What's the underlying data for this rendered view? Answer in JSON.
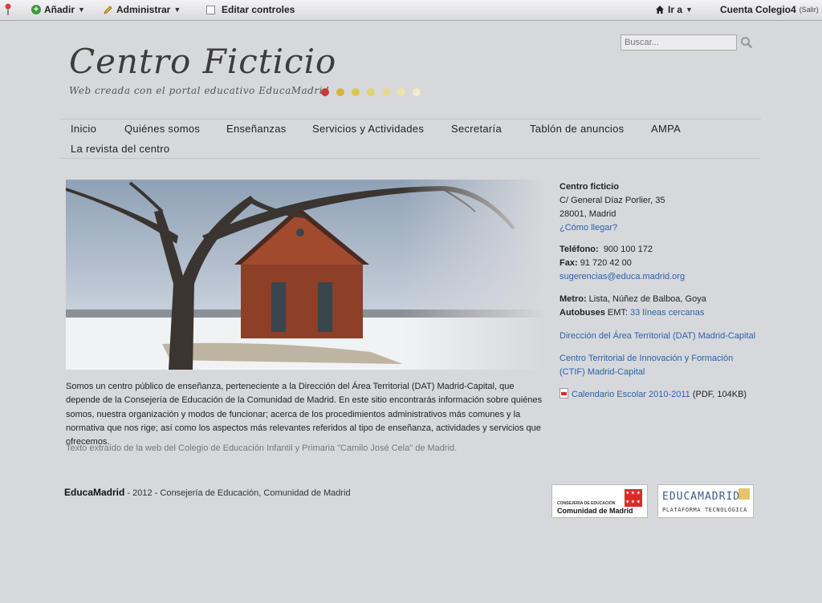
{
  "toolbar": {
    "add_label": "Añadir",
    "admin_label": "Administrar",
    "edit_controls_label": "Editar controles",
    "goto_label": "Ir a",
    "account_label": "Cuenta Colegio4",
    "logout_label": "(Salir)"
  },
  "header": {
    "title": "Centro Ficticio",
    "subtitle": "Web creada con el portal educativo EducaMadrid",
    "dot_colors": [
      "#cc3b33",
      "#d6b43a",
      "#ddc64f",
      "#e3d170",
      "#e8da8c",
      "#eee3a9",
      "#f2ecc8"
    ]
  },
  "search": {
    "placeholder": "Buscar..."
  },
  "nav": {
    "items": [
      "Inicio",
      "Quiénes somos",
      "Enseñanzas",
      "Servicios y Actividades",
      "Secretaría",
      "Tablón de anuncios",
      "AMPA",
      "La revista del centro"
    ]
  },
  "main": {
    "intro": "Somos un centro público de enseñanza, perteneciente a la Dirección del Área Territorial (DAT) Madrid-Capital, que depende de la Consejería de Educación de la Comunidad de Madrid. En este sitio encontrarás información sobre quiénes somos, nuestra organización y modos de funcionar; acerca de los procedimientos administrativos más comunes y la normativa que nos rige; así como los aspectos más relevantes referidos al tipo de enseñanza, actividades y servicios que ofrecemos.",
    "source_note": "Texto extraído de la web del Colegio de Educación Infantil y Primaria \"Camilo José Cela\" de Madrid."
  },
  "sidebar": {
    "school_name": "Centro ficticio",
    "address_line1": "C/ General Díaz Porlier, 35",
    "address_line2": "28001, Madrid",
    "directions_link": "¿Cómo llegar?",
    "phone_label": "Teléfono:",
    "phone_value": "900 100 172",
    "fax_label": "Fax:",
    "fax_value": "91 720 42 00",
    "email": "sugerencias@educa.madrid.org",
    "metro_label": "Metro:",
    "metro_value": "Lista, Núñez de Balboa, Goya",
    "bus_label": "Autobuses",
    "bus_emt": "EMT:",
    "bus_link": "33 líneas cercanas",
    "dat_link": "Dirección del Área Territorial (DAT) Madrid-Capital",
    "ctif_link": "Centro Territorial de Innovación y Formación (CTIF) Madrid-Capital",
    "calendar_link": "Calendario Escolar 2010-2011",
    "calendar_meta": "(PDF, 104KB)"
  },
  "footer": {
    "brand": "EducaMadrid",
    "text": " - 2012 - Consejería de Educación, Comunidad de Madrid",
    "badge1_line1": "CONSEJERÍA DE EDUCACIÓN",
    "badge1_line2": "Comunidad de Madrid",
    "badge2_line1": "EDUCAMADRID",
    "badge2_line2": "PLATAFORMA TECNOLÓGICA"
  }
}
